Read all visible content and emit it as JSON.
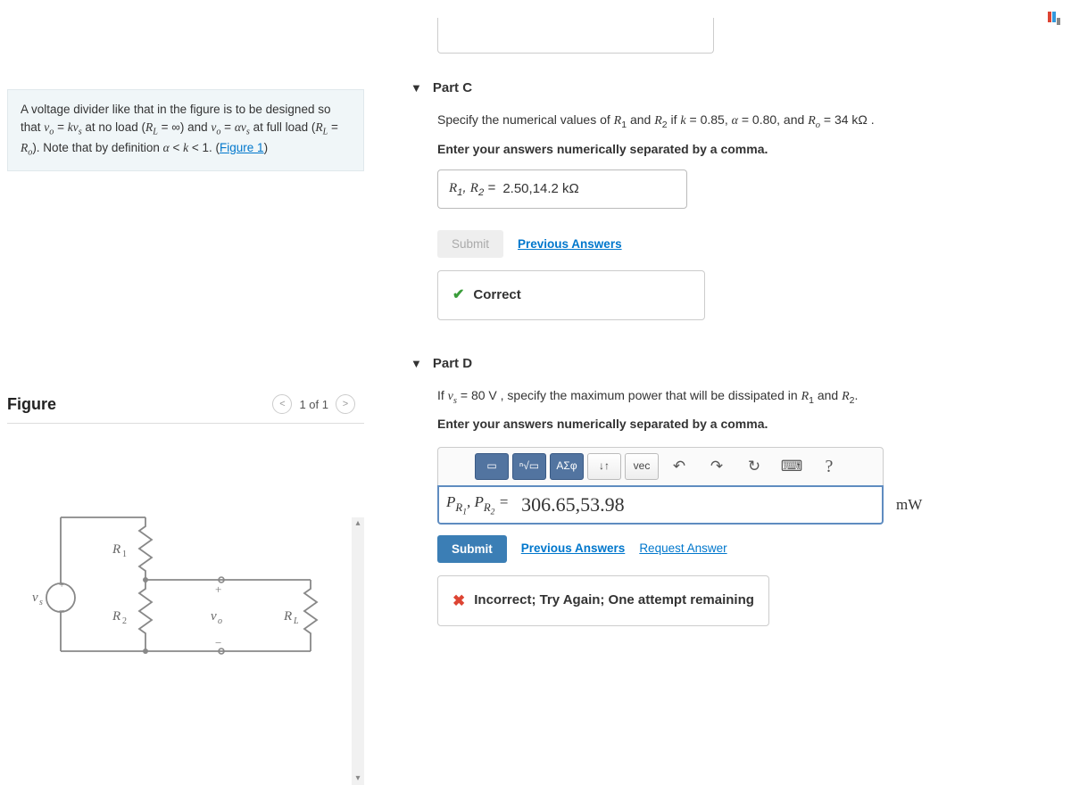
{
  "problem": {
    "text_1": "A voltage divider like that in the figure is to be designed so that ",
    "eq1": "v_o = kv_s",
    "text_2": " at no load ",
    "eq2": "(R_L = ∞)",
    "text_3": " and ",
    "eq3": "v_o = αv_s",
    "text_4": " at full load ",
    "eq4": "(R_L = R_o)",
    "text_5": ". Note that by definition ",
    "eq5": "α < k < 1",
    "text_6": ". (",
    "figure_link": "Figure 1",
    "text_7": ")"
  },
  "figure": {
    "title": "Figure",
    "pager": "1 of 1",
    "labels": {
      "vs": "v_s",
      "r1": "R_1",
      "r2": "R_2",
      "vo": "v_o",
      "rl": "R_L",
      "plus": "+",
      "minus": "−"
    }
  },
  "partC": {
    "title": "Part C",
    "prompt_1": "Specify the numerical values of ",
    "prompt_2": " and ",
    "prompt_3": " if ",
    "vals": "k = 0.85, α = 0.80, and R_o = 34 kΩ .",
    "instruction": "Enter your answers numerically separated by a comma.",
    "answer_prefix": "R_1, R_2 = ",
    "answer_value": "2.50,14.2  kΩ",
    "submit": "Submit",
    "prev": "Previous Answers",
    "feedback": "Correct"
  },
  "partD": {
    "title": "Part D",
    "prompt_1": "If ",
    "prompt_2": " , specify the maximum power that will be dissipated in ",
    "prompt_3": " and ",
    "vs_val": "v_s = 80 V",
    "instruction": "Enter your answers numerically separated by a comma.",
    "toolbar": {
      "sqrt": "√",
      "greek": "ΑΣφ",
      "updown": "↓↑",
      "vec": "vec",
      "undo": "↶",
      "redo": "↷",
      "refresh": "↻",
      "keyboard": "⌨",
      "help": "?"
    },
    "input_prefix": "P_{R1}, P_{R2} = ",
    "input_value": "306.65,53.98",
    "unit": "mW",
    "submit": "Submit",
    "prev": "Previous Answers",
    "request": "Request Answer",
    "feedback": "Incorrect; Try Again; One attempt remaining"
  }
}
